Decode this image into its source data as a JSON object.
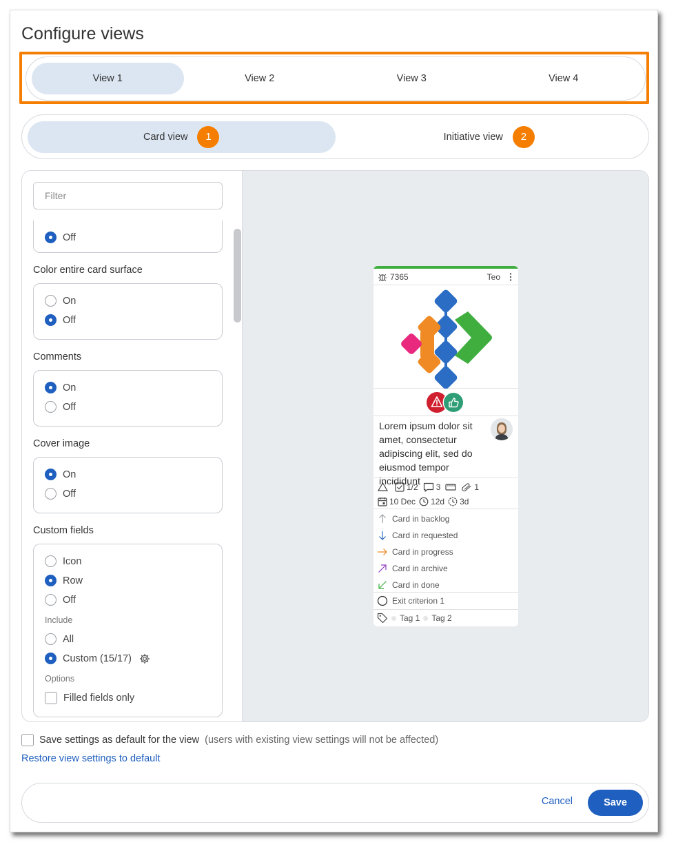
{
  "dialog": {
    "title": "Configure views"
  },
  "views": {
    "tabs": [
      {
        "label": "View 1",
        "active": true
      },
      {
        "label": "View 2",
        "active": false
      },
      {
        "label": "View 3",
        "active": false
      },
      {
        "label": "View 4",
        "active": false
      }
    ]
  },
  "modes": {
    "tabs": [
      {
        "label": "Card view",
        "badge": "1",
        "active": true
      },
      {
        "label": "Initiative view",
        "badge": "2",
        "active": false
      }
    ]
  },
  "settings": {
    "filter_placeholder": "Filter",
    "partial_option_label": "Off",
    "color_surface": {
      "label": "Color entire card surface",
      "on": "On",
      "off": "Off",
      "selected": "Off"
    },
    "comments": {
      "label": "Comments",
      "on": "On",
      "off": "Off",
      "selected": "On"
    },
    "cover_image": {
      "label": "Cover image",
      "on": "On",
      "off": "Off",
      "selected": "On"
    },
    "custom_fields": {
      "label": "Custom fields",
      "options": [
        "Icon",
        "Row",
        "Off"
      ],
      "selected": "Row",
      "include_label": "Include",
      "include_all": "All",
      "include_custom": "Custom (15/17)",
      "include_selected": "Custom (15/17)",
      "options_label": "Options",
      "filled_only": "Filled fields only"
    }
  },
  "card": {
    "id": "7365",
    "owner": "Teo",
    "description": "Lorem ipsum dolor sit amet, consectetur adipiscing elit, sed do eiusmod tempor incididunt",
    "metrics": {
      "checklist": "1/2",
      "comments": "3",
      "attachments": "1",
      "date": "10 Dec",
      "age": "12d",
      "time": "3d"
    },
    "statuses": [
      {
        "label": "Card in backlog",
        "color": "#9a9ea4",
        "icon": "arrow-up-icon"
      },
      {
        "label": "Card in requested",
        "color": "#2b6cc4",
        "icon": "arrow-down-icon"
      },
      {
        "label": "Card in progress",
        "color": "#f08a24",
        "icon": "arrow-right-icon"
      },
      {
        "label": "Card in archive",
        "color": "#8e3fbf",
        "icon": "arrow-up-right-icon"
      },
      {
        "label": "Card in done",
        "color": "#3fae3f",
        "icon": "arrow-down-left-icon"
      }
    ],
    "exit_criterion": "Exit criterion 1",
    "tags": [
      "Tag 1",
      "Tag 2"
    ]
  },
  "footer": {
    "default_label": "Save settings as default for the view",
    "default_note": "(users with existing view settings will not be affected)",
    "restore": "Restore view settings to default",
    "cancel": "Cancel",
    "save": "Save"
  },
  "colors": {
    "accent": "#1f5fbf",
    "highlight": "#f57e00",
    "active_pill": "#dce6f2",
    "card_top": "#3fae3f"
  }
}
